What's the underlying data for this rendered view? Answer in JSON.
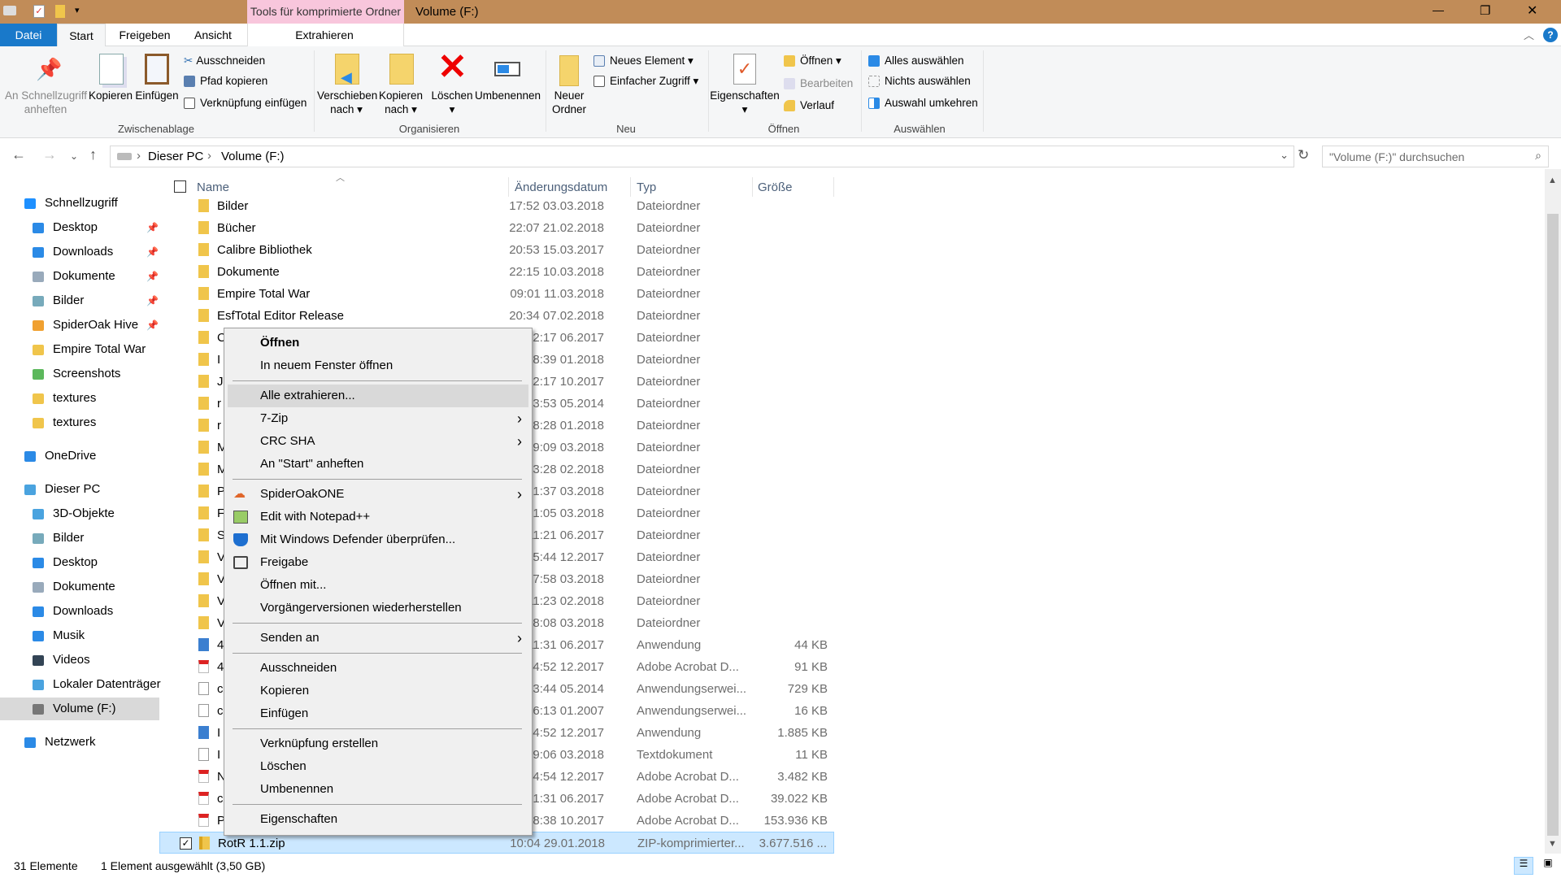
{
  "window": {
    "title": "Volume (F:)",
    "context_tab": "Tools für komprimierte Ordner",
    "minimize": "—",
    "restore": "❐",
    "close": "✕"
  },
  "tabs": [
    {
      "label": "Datei"
    },
    {
      "label": "Start"
    },
    {
      "label": "Freigeben"
    },
    {
      "label": "Ansicht"
    },
    {
      "label": "Extrahieren"
    }
  ],
  "ribbon": {
    "clipboard": {
      "pin_l1": "An Schnellzugriff",
      "pin_l2": "anheften",
      "copy": "Kopieren",
      "paste": "Einfügen",
      "cut": "Ausschneiden",
      "copy_path": "Pfad kopieren",
      "paste_link": "Verknüpfung einfügen",
      "group": "Zwischenablage"
    },
    "organize": {
      "move_l1": "Verschieben",
      "move_l2": "nach ▾",
      "copyto_l1": "Kopieren",
      "copyto_l2": "nach ▾",
      "delete": "Löschen",
      "delete_arrow": "▾",
      "rename": "Umbenennen",
      "group": "Organisieren"
    },
    "new": {
      "folder_l1": "Neuer",
      "folder_l2": "Ordner",
      "new_item": "Neues Element ▾",
      "easy_access": "Einfacher Zugriff ▾",
      "group": "Neu"
    },
    "open": {
      "props": "Eigenschaften",
      "props_arrow": "▾",
      "open": "Öffnen ▾",
      "edit": "Bearbeiten",
      "history": "Verlauf",
      "group": "Öffnen"
    },
    "select": {
      "all": "Alles auswählen",
      "none": "Nichts auswählen",
      "invert": "Auswahl umkehren",
      "group": "Auswählen"
    }
  },
  "address": {
    "crumbs": [
      "Dieser PC",
      "Volume (F:)"
    ],
    "sep": "›",
    "search_placeholder": "\"Volume (F:)\" durchsuchen"
  },
  "sidebar": [
    {
      "label": "Schnellzugriff",
      "level": 0,
      "icon": "star-icon",
      "color": "#1e90ff"
    },
    {
      "label": "Desktop",
      "level": 1,
      "icon": "desktop-icon",
      "pin": true,
      "color": "#2b8ae6"
    },
    {
      "label": "Downloads",
      "level": 1,
      "icon": "download-icon",
      "pin": true,
      "color": "#2b8ae6"
    },
    {
      "label": "Dokumente",
      "level": 1,
      "icon": "documents-icon",
      "pin": true,
      "color": "#9ab"
    },
    {
      "label": "Bilder",
      "level": 1,
      "icon": "pictures-icon",
      "pin": true,
      "color": "#7ab"
    },
    {
      "label": "SpiderOak Hive",
      "level": 1,
      "icon": "spideroak-icon",
      "pin": true,
      "color": "#f0a030"
    },
    {
      "label": "Empire Total War",
      "level": 1,
      "icon": "folder-icon",
      "color": "#f0c54b"
    },
    {
      "label": "Screenshots",
      "level": 1,
      "icon": "screenshots-icon",
      "color": "#5cb85c"
    },
    {
      "label": "textures",
      "level": 1,
      "icon": "folder-icon",
      "color": "#f0c54b"
    },
    {
      "label": "textures",
      "level": 1,
      "icon": "folder-icon",
      "color": "#f0c54b"
    },
    {
      "label": "OneDrive",
      "level": 0,
      "icon": "onedrive-icon",
      "color": "#2b8ae6",
      "gap": true
    },
    {
      "label": "Dieser PC",
      "level": 0,
      "icon": "computer-icon",
      "color": "#4aa3df",
      "gap": true
    },
    {
      "label": "3D-Objekte",
      "level": 1,
      "icon": "3d-objects-icon",
      "color": "#4aa3df"
    },
    {
      "label": "Bilder",
      "level": 1,
      "icon": "pictures-icon",
      "color": "#7ab"
    },
    {
      "label": "Desktop",
      "level": 1,
      "icon": "desktop-icon",
      "color": "#2b8ae6"
    },
    {
      "label": "Dokumente",
      "level": 1,
      "icon": "documents-icon",
      "color": "#9ab"
    },
    {
      "label": "Downloads",
      "level": 1,
      "icon": "download-icon",
      "color": "#2b8ae6"
    },
    {
      "label": "Musik",
      "level": 1,
      "icon": "music-icon",
      "color": "#2b8ae6"
    },
    {
      "label": "Videos",
      "level": 1,
      "icon": "videos-icon",
      "color": "#345"
    },
    {
      "label": "Lokaler Datenträger",
      "level": 1,
      "icon": "drive-icon",
      "color": "#4aa3df"
    },
    {
      "label": "Volume (F:)",
      "level": 1,
      "icon": "drive-icon",
      "color": "#777",
      "selected": true
    },
    {
      "label": "Netzwerk",
      "level": 0,
      "icon": "network-icon",
      "color": "#2b8ae6",
      "gap": true
    }
  ],
  "columns": {
    "name": "Name",
    "date": "Änderungsdatum",
    "type": "Typ",
    "size": "Größe"
  },
  "files": [
    {
      "name": "Bilder",
      "date": "03.03.2018 17:52",
      "type": "Dateiordner",
      "size": "",
      "icon": "folder"
    },
    {
      "name": "Bücher",
      "date": "21.02.2018 22:07",
      "type": "Dateiordner",
      "size": "",
      "icon": "folder"
    },
    {
      "name": "Calibre Bibliothek",
      "date": "15.03.2017 20:53",
      "type": "Dateiordner",
      "size": "",
      "icon": "folder"
    },
    {
      "name": "Dokumente",
      "date": "10.03.2018 22:15",
      "type": "Dateiordner",
      "size": "",
      "icon": "folder"
    },
    {
      "name": "Empire Total War",
      "date": "11.03.2018 09:01",
      "type": "Dateiordner",
      "size": "",
      "icon": "folder"
    },
    {
      "name": "EsfTotal Editor Release",
      "date": "07.02.2018 20:34",
      "type": "Dateiordner",
      "size": "",
      "icon": "folder"
    },
    {
      "name": "C",
      "date": "06.2017 12:17",
      "type": "Dateiordner",
      "size": "",
      "icon": "folder"
    },
    {
      "name": "I",
      "date": "01.2018 18:39",
      "type": "Dateiordner",
      "size": "",
      "icon": "folder"
    },
    {
      "name": "J",
      "date": "10.2017 22:17",
      "type": "Dateiordner",
      "size": "",
      "icon": "folder"
    },
    {
      "name": "r",
      "date": "05.2014 23:53",
      "type": "Dateiordner",
      "size": "",
      "icon": "folder"
    },
    {
      "name": "r",
      "date": "01.2018 18:28",
      "type": "Dateiordner",
      "size": "",
      "icon": "folder"
    },
    {
      "name": "M",
      "date": "03.2018 09:09",
      "type": "Dateiordner",
      "size": "",
      "icon": "folder"
    },
    {
      "name": "M",
      "date": "02.2018 13:28",
      "type": "Dateiordner",
      "size": "",
      "icon": "folder"
    },
    {
      "name": "P",
      "date": "03.2018 21:37",
      "type": "Dateiordner",
      "size": "",
      "icon": "folder"
    },
    {
      "name": "F",
      "date": "03.2018 21:05",
      "type": "Dateiordner",
      "size": "",
      "icon": "folder"
    },
    {
      "name": "S",
      "date": "06.2017 11:21",
      "type": "Dateiordner",
      "size": "",
      "icon": "folder"
    },
    {
      "name": "V",
      "date": "12.2017 15:44",
      "type": "Dateiordner",
      "size": "",
      "icon": "folder"
    },
    {
      "name": "V",
      "date": "03.2018 07:58",
      "type": "Dateiordner",
      "size": "",
      "icon": "folder"
    },
    {
      "name": "V",
      "date": "02.2018 11:23",
      "type": "Dateiordner",
      "size": "",
      "icon": "folder"
    },
    {
      "name": "V",
      "date": "03.2018 08:08",
      "type": "Dateiordner",
      "size": "",
      "icon": "folder"
    },
    {
      "name": "4",
      "date": "06.2017 11:31",
      "type": "Anwendung",
      "size": "44 KB",
      "icon": "app"
    },
    {
      "name": "4",
      "date": "12.2017 14:52",
      "type": "Adobe Acrobat D...",
      "size": "91 KB",
      "icon": "pdf"
    },
    {
      "name": "c",
      "date": "05.2014 23:44",
      "type": "Anwendungserwei...",
      "size": "729 KB",
      "icon": "dll"
    },
    {
      "name": "c",
      "date": "01.2007 16:13",
      "type": "Anwendungserwei...",
      "size": "16 KB",
      "icon": "dll"
    },
    {
      "name": "I",
      "date": "12.2017 14:52",
      "type": "Anwendung",
      "size": "1.885 KB",
      "icon": "app"
    },
    {
      "name": "I",
      "date": "03.2018 09:06",
      "type": "Textdokument",
      "size": "11 KB",
      "icon": "txt"
    },
    {
      "name": "N",
      "date": "12.2017 14:54",
      "type": "Adobe Acrobat D...",
      "size": "3.482 KB",
      "icon": "pdf"
    },
    {
      "name": "c",
      "date": "06.2017 21:31",
      "type": "Adobe Acrobat D...",
      "size": "39.022 KB",
      "icon": "pdf"
    },
    {
      "name": "P",
      "date": "10.2017 18:38",
      "type": "Adobe Acrobat D...",
      "size": "153.936 KB",
      "icon": "pdf"
    },
    {
      "name": "RotR 1.1.zip",
      "date": "29.01.2018 10:04",
      "type": "ZIP-komprimierter...",
      "size": "3.677.516 ...",
      "icon": "zip",
      "selected": true
    }
  ],
  "menu": [
    {
      "label": "Öffnen",
      "bold": true
    },
    {
      "label": "In neuem Fenster öffnen"
    },
    {
      "sep": true
    },
    {
      "label": "Alle extrahieren...",
      "highlight": true
    },
    {
      "label": "7-Zip",
      "sub": true
    },
    {
      "label": "CRC SHA",
      "sub": true
    },
    {
      "label": "An \"Start\" anheften"
    },
    {
      "sep": true
    },
    {
      "label": "SpiderOakONE",
      "sub": true,
      "icon": "spideroak-icon"
    },
    {
      "label": "Edit with Notepad++",
      "icon": "notepad-icon"
    },
    {
      "label": "Mit Windows Defender überprüfen...",
      "icon": "shield-icon"
    },
    {
      "label": "Freigabe",
      "icon": "share-icon"
    },
    {
      "label": "Öffnen mit..."
    },
    {
      "label": "Vorgängerversionen wiederherstellen"
    },
    {
      "sep": true
    },
    {
      "label": "Senden an",
      "sub": true
    },
    {
      "sep": true
    },
    {
      "label": "Ausschneiden"
    },
    {
      "label": "Kopieren"
    },
    {
      "label": "Einfügen"
    },
    {
      "sep": true
    },
    {
      "label": "Verknüpfung erstellen"
    },
    {
      "label": "Löschen"
    },
    {
      "label": "Umbenennen"
    },
    {
      "sep": true
    },
    {
      "label": "Eigenschaften"
    }
  ],
  "status": {
    "count": "31 Elemente",
    "selection": "1 Element ausgewählt (3,50 GB)"
  },
  "colors": {
    "accent": "#1979ca",
    "selection": "#cce8ff",
    "titlebar": "#c18c58",
    "context_tab": "#f8c6dc"
  }
}
